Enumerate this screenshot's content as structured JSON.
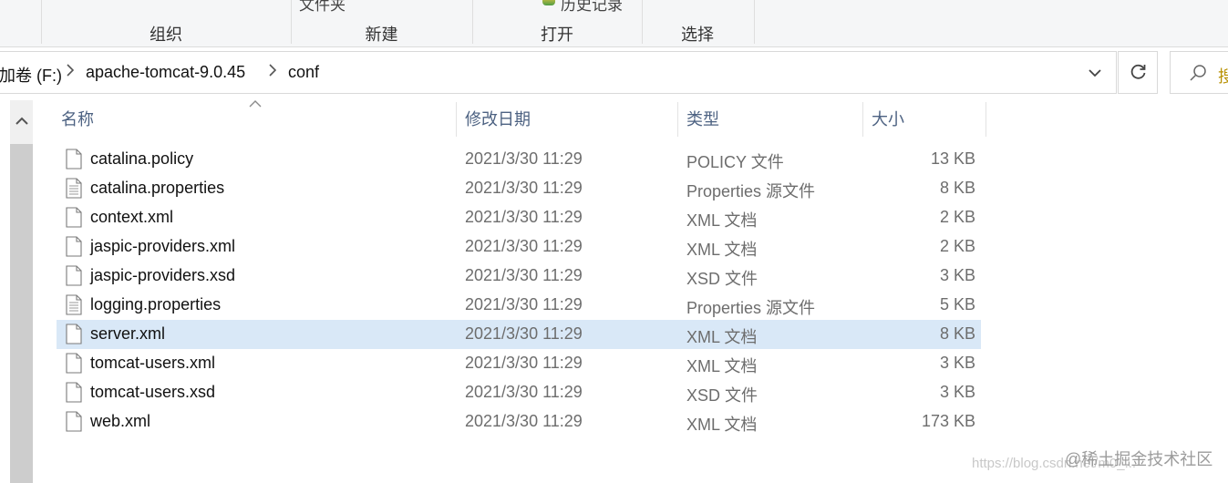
{
  "ribbon": {
    "groups": [
      "组织",
      "新建",
      "打开",
      "选择"
    ],
    "fragment_folder": "文件夹",
    "fragment_history": "历史记录"
  },
  "address": {
    "crumbs": [
      "加卷 (F:)",
      "apache-tomcat-9.0.45",
      "conf"
    ],
    "search_fragment": "搜"
  },
  "columns": {
    "name": "名称",
    "modified": "修改日期",
    "type": "类型",
    "size": "大小"
  },
  "files": [
    {
      "name": "catalina.policy",
      "modified": "2021/3/30 11:29",
      "type": "POLICY 文件",
      "size": "13 KB",
      "icon": "file-icon"
    },
    {
      "name": "catalina.properties",
      "modified": "2021/3/30 11:29",
      "type": "Properties 源文件",
      "size": "8 KB",
      "icon": "text-file-icon"
    },
    {
      "name": "context.xml",
      "modified": "2021/3/30 11:29",
      "type": "XML 文档",
      "size": "2 KB",
      "icon": "file-icon"
    },
    {
      "name": "jaspic-providers.xml",
      "modified": "2021/3/30 11:29",
      "type": "XML 文档",
      "size": "2 KB",
      "icon": "file-icon"
    },
    {
      "name": "jaspic-providers.xsd",
      "modified": "2021/3/30 11:29",
      "type": "XSD 文件",
      "size": "3 KB",
      "icon": "file-icon"
    },
    {
      "name": "logging.properties",
      "modified": "2021/3/30 11:29",
      "type": "Properties 源文件",
      "size": "5 KB",
      "icon": "text-file-icon"
    },
    {
      "name": "server.xml",
      "modified": "2021/3/30 11:29",
      "type": "XML 文档",
      "size": "8 KB",
      "icon": "file-icon",
      "selected": true
    },
    {
      "name": "tomcat-users.xml",
      "modified": "2021/3/30 11:29",
      "type": "XML 文档",
      "size": "3 KB",
      "icon": "file-icon"
    },
    {
      "name": "tomcat-users.xsd",
      "modified": "2021/3/30 11:29",
      "type": "XSD 文件",
      "size": "3 KB",
      "icon": "file-icon"
    },
    {
      "name": "web.xml",
      "modified": "2021/3/30 11:29",
      "type": "XML 文档",
      "size": "173 KB",
      "icon": "file-icon"
    }
  ],
  "watermark": {
    "brand": "@稀土掘金技术社区",
    "url": "https://blog.csdn.net/m0_..."
  },
  "colors": {
    "selected_row": "#d9e8f7",
    "header_text": "#4d6282"
  }
}
